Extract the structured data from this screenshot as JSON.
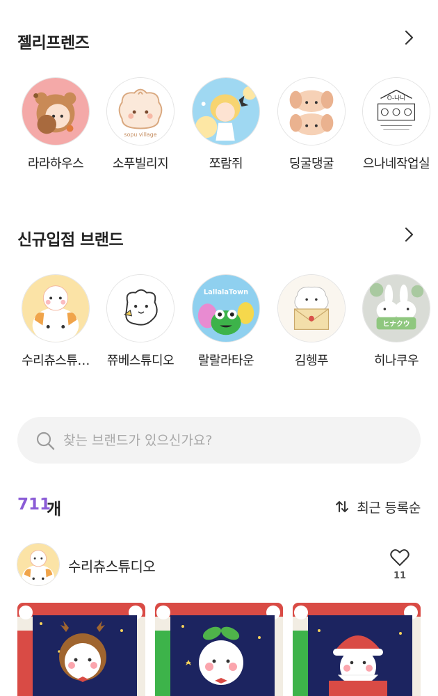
{
  "jelly_friends": {
    "title": "젤리프렌즈",
    "brands": [
      {
        "name": "라라하우스",
        "logo": "bear-costume-girl-logo",
        "bg": "#f4a9a8"
      },
      {
        "name": "소푸빌리지",
        "logo": "sopu-village-logo",
        "bg": "#ffffff",
        "logo_text": "sopu village"
      },
      {
        "name": "쪼람쥐",
        "logo": "blonde-girl-logo",
        "bg": "#9fd8f2"
      },
      {
        "name": "딩굴댕굴",
        "logo": "puppy-face-logo",
        "bg": "#ffffff"
      },
      {
        "name": "으나네작업실",
        "logo": "onane-studio-logo",
        "bg": "#ffffff",
        "logo_text": "O-나니"
      }
    ]
  },
  "new_brands": {
    "title": "신규입점 브랜드",
    "brands": [
      {
        "name": "수리츄스튜…",
        "logo": "calico-cat-logo",
        "bg": "#fbe3a6"
      },
      {
        "name": "쮸베스튜디오",
        "logo": "white-creature-logo",
        "bg": "#ffffff"
      },
      {
        "name": "랄랄라타운",
        "logo": "lallala-town-logo",
        "bg": "#8fd0ef",
        "logo_text": "LallalaTown"
      },
      {
        "name": "김헹푸",
        "logo": "envelope-dog-logo",
        "bg": "#faf6ef"
      },
      {
        "name": "히나쿠우",
        "logo": "bunnies-logo",
        "bg": "#d9dcd6",
        "logo_text": "ヒナクウ"
      }
    ]
  },
  "search": {
    "placeholder": "찾는 브랜드가 있으신가요?"
  },
  "results": {
    "count": "711",
    "unit": "개",
    "sort_label": "최근 등록순"
  },
  "featured_brand": {
    "name": "수리츄스튜디오",
    "likes": "11"
  },
  "products": [
    {
      "name": "reindeer-sticker-card"
    },
    {
      "name": "sprout-sticker-card"
    },
    {
      "name": "santa-sticker-card"
    }
  ],
  "colors": {
    "accent": "#8a5bd6",
    "search_bg": "#f3f3f3",
    "text": "#222222"
  }
}
